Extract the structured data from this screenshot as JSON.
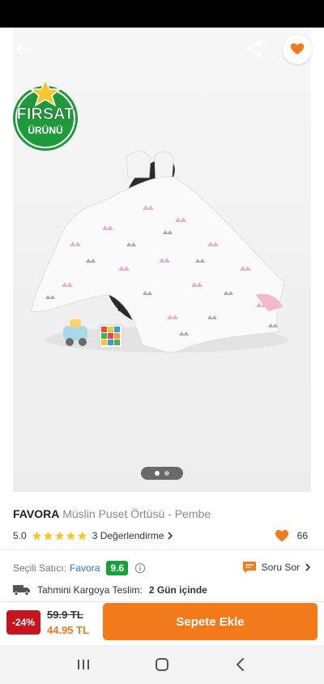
{
  "colors": {
    "accent": "#f27a1a",
    "discount": "#c8141e",
    "seller_score": "#14a33b",
    "seller_link": "#2a6fc9",
    "badge_green": "#1f9a3a",
    "badge_star": "#f8c62b"
  },
  "header": {
    "back_icon": "arrow-left-icon",
    "share_icon": "share-icon",
    "favorite_icon": "heart-icon"
  },
  "badge": {
    "line1": "FIRSAT",
    "line2": "ÜRÜNÜ"
  },
  "gallery": {
    "page_count": 2,
    "active_index": 0
  },
  "product": {
    "brand": "FAVORA",
    "name": "Müslin Puset Örtüsü - Pembe",
    "rating": "5.0",
    "stars": 5,
    "reviews_label": "3 Değerlendirme",
    "likes": "66"
  },
  "seller": {
    "label": "Seçili Satıcı:",
    "name": "Favora",
    "score": "9.6",
    "ask_label": "Soru Sor"
  },
  "shipping": {
    "label": "Tahmini Kargoya Teslim:",
    "value": "2 Gün içinde"
  },
  "purchase": {
    "discount": "-24%",
    "old_price": "59.9 TL",
    "new_price": "44.95 TL",
    "add_to_cart": "Sepete Ekle"
  },
  "navbar": {
    "items": [
      "recent-apps-icon",
      "home-icon",
      "back-icon"
    ]
  }
}
